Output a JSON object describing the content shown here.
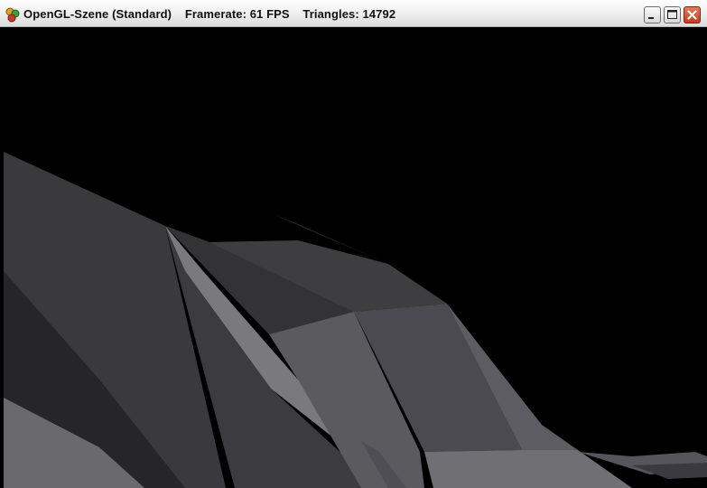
{
  "window": {
    "title_scene": "OpenGL-Szene (Standard)",
    "title_framerate": "Framerate: 61 FPS",
    "title_triangles": "Triangles: 14792",
    "icon": "opengl-app-icon",
    "controls": {
      "minimize_icon": "minimize-icon",
      "maximize_icon": "maximize-icon",
      "close_icon": "close-icon"
    }
  },
  "scene": {
    "background": "#000000",
    "palette": [
      "#3a3a3d",
      "#2c2c2e",
      "#48484c",
      "#5a5a5f",
      "#6f6f72",
      "#7c7c80",
      "#1e1e22"
    ]
  }
}
